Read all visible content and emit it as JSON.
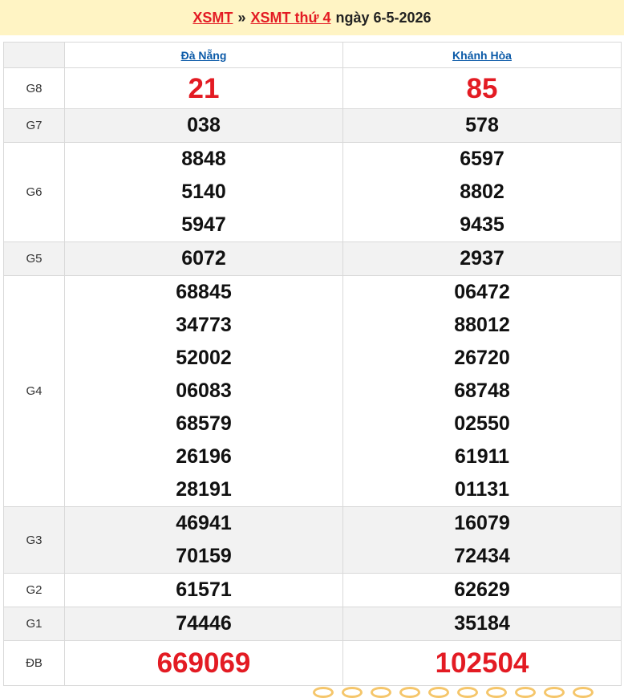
{
  "header": {
    "link1": "XSMT",
    "separator": "»",
    "link2": "XSMT thứ 4",
    "date_text": "ngày 6-5-2026"
  },
  "provinces": [
    "Đà Nẵng",
    "Khánh Hòa"
  ],
  "colors": {
    "accent_red": "#e31b23",
    "link_blue": "#0b5aa8",
    "header_bg": "#fff4c4"
  },
  "rows": [
    {
      "label": "G8",
      "a": [
        "21"
      ],
      "b": [
        "85"
      ]
    },
    {
      "label": "G7",
      "a": [
        "038"
      ],
      "b": [
        "578"
      ]
    },
    {
      "label": "G6",
      "a": [
        "8848",
        "5140",
        "5947"
      ],
      "b": [
        "6597",
        "8802",
        "9435"
      ]
    },
    {
      "label": "G5",
      "a": [
        "6072"
      ],
      "b": [
        "2937"
      ]
    },
    {
      "label": "G4",
      "a": [
        "68845",
        "34773",
        "52002",
        "06083",
        "68579",
        "26196",
        "28191"
      ],
      "b": [
        "06472",
        "88012",
        "26720",
        "68748",
        "02550",
        "61911",
        "01131"
      ]
    },
    {
      "label": "G3",
      "a": [
        "46941",
        "70159"
      ],
      "b": [
        "16079",
        "72434"
      ]
    },
    {
      "label": "G2",
      "a": [
        "61571"
      ],
      "b": [
        "62629"
      ]
    },
    {
      "label": "G1",
      "a": [
        "74446"
      ],
      "b": [
        "35184"
      ]
    },
    {
      "label": "ĐB",
      "a": [
        "669069"
      ],
      "b": [
        "102504"
      ]
    }
  ]
}
